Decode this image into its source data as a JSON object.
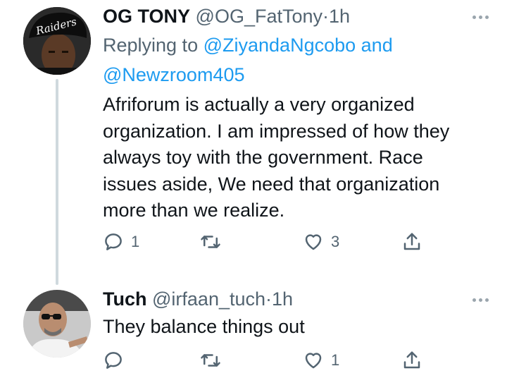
{
  "tweets": [
    {
      "name": "OG TONY",
      "handle": "@OG_FatTony",
      "sep": "·",
      "time": "1h",
      "reply_prefix": "Replying to",
      "reply_user1": "@ZiyandaNgcobo",
      "reply_and": "and",
      "reply_user2": "@Newzroom405",
      "lines": [
        "Afriforum is actually a very organized",
        "organization. I am impressed of how they",
        "always toy with the government. Race",
        "issues aside, We need that organization",
        "more than we realize."
      ],
      "reply_count": "1",
      "retweet_count": "",
      "like_count": "3",
      "avatar_icon": "raiders-cap-avatar"
    },
    {
      "name": "Tuch",
      "handle": "@irfaan_tuch",
      "sep": "·",
      "time": "1h",
      "lines": [
        "They balance things out"
      ],
      "reply_count": "",
      "retweet_count": "",
      "like_count": "1",
      "avatar_icon": "sunglasses-man-avatar"
    }
  ],
  "colors": {
    "text": "#0f1419",
    "secondary": "#536471",
    "link": "#1d9bf0",
    "thread_line": "#cfd9de"
  }
}
